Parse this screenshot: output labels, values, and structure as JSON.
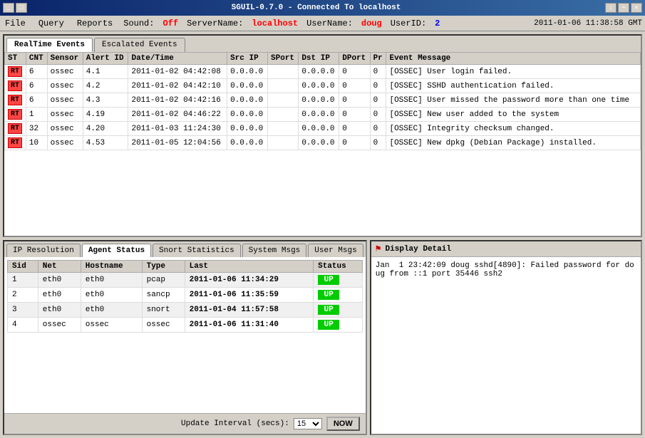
{
  "titleBar": {
    "title": "SGUIL-0.7.0 - Connected To localhost",
    "controls": [
      "minimize",
      "maximize",
      "close"
    ],
    "datetime": "2011-01-06 11:38:58 GMT"
  },
  "menuBar": {
    "items": [
      {
        "label": "File",
        "id": "file"
      },
      {
        "label": "Query",
        "id": "query"
      },
      {
        "label": "Reports",
        "id": "reports"
      }
    ],
    "sound": {
      "label": "Sound:",
      "value": "Off"
    },
    "serverName": {
      "label": "ServerName:",
      "value": "localhost"
    },
    "userName": {
      "label": "UserName:",
      "value": "doug"
    },
    "userId": {
      "label": "UserID:",
      "value": "2"
    }
  },
  "topPanel": {
    "tabs": [
      {
        "label": "RealTime Events",
        "id": "realtime",
        "active": true
      },
      {
        "label": "Escalated Events",
        "id": "escalated",
        "active": false
      }
    ],
    "tableHeaders": [
      "ST",
      "CNT",
      "Sensor",
      "Alert ID",
      "Date/Time",
      "Src IP",
      "SPort",
      "Dst IP",
      "DPort",
      "Pr",
      "Event Message"
    ],
    "rows": [
      {
        "st": "RT",
        "cnt": "6",
        "sensor": "ossec",
        "alertId": "4.1",
        "datetime": "2011-01-02 04:42:08",
        "srcIp": "0.0.0.0",
        "sport": "",
        "dstIp": "0.0.0.0",
        "dport": "0",
        "pr": "0",
        "message": "[OSSEC] User login failed."
      },
      {
        "st": "RT",
        "cnt": "6",
        "sensor": "ossec",
        "alertId": "4.2",
        "datetime": "2011-01-02 04:42:10",
        "srcIp": "0.0.0.0",
        "sport": "",
        "dstIp": "0.0.0.0",
        "dport": "0",
        "pr": "0",
        "message": "[OSSEC] SSHD authentication failed."
      },
      {
        "st": "RT",
        "cnt": "6",
        "sensor": "ossec",
        "alertId": "4.3",
        "datetime": "2011-01-02 04:42:16",
        "srcIp": "0.0.0.0",
        "sport": "",
        "dstIp": "0.0.0.0",
        "dport": "0",
        "pr": "0",
        "message": "[OSSEC] User missed the password more than one time"
      },
      {
        "st": "RT",
        "cnt": "1",
        "sensor": "ossec",
        "alertId": "4.19",
        "datetime": "2011-01-02 04:46:22",
        "srcIp": "0.0.0.0",
        "sport": "",
        "dstIp": "0.0.0.0",
        "dport": "0",
        "pr": "0",
        "message": "[OSSEC] New user added to the system"
      },
      {
        "st": "RT",
        "cnt": "32",
        "sensor": "ossec",
        "alertId": "4.20",
        "datetime": "2011-01-03 11:24:30",
        "srcIp": "0.0.0.0",
        "sport": "",
        "dstIp": "0.0.0.0",
        "dport": "0",
        "pr": "0",
        "message": "[OSSEC] Integrity checksum changed."
      },
      {
        "st": "RT",
        "cnt": "10",
        "sensor": "ossec",
        "alertId": "4.53",
        "datetime": "2011-01-05 12:04:56",
        "srcIp": "0.0.0.0",
        "sport": "",
        "dstIp": "0.0.0.0",
        "dport": "0",
        "pr": "0",
        "message": "[OSSEC] New dpkg (Debian Package) installed."
      }
    ]
  },
  "bottomLeft": {
    "tabs": [
      {
        "label": "IP Resolution",
        "id": "ip-resolution",
        "active": false
      },
      {
        "label": "Agent Status",
        "id": "agent-status",
        "active": true
      },
      {
        "label": "Snort Statistics",
        "id": "snort-statistics",
        "active": false
      },
      {
        "label": "System Msgs",
        "id": "system-msgs",
        "active": false
      },
      {
        "label": "User Msgs",
        "id": "user-msgs",
        "active": false
      }
    ],
    "agentTable": {
      "headers": [
        "Sid",
        "Net",
        "Hostname",
        "Type",
        "Last",
        "Status"
      ],
      "rows": [
        {
          "sid": "1",
          "net": "eth0",
          "hostname": "eth0",
          "type": "pcap",
          "last": "2011-01-06 11:34:29",
          "status": "UP"
        },
        {
          "sid": "2",
          "net": "eth0",
          "hostname": "eth0",
          "type": "sancp",
          "last": "2011-01-06 11:35:59",
          "status": "UP"
        },
        {
          "sid": "3",
          "net": "eth0",
          "hostname": "eth0",
          "type": "snort",
          "last": "2011-01-04 11:57:58",
          "status": "UP"
        },
        {
          "sid": "4",
          "net": "ossec",
          "hostname": "ossec",
          "type": "ossec",
          "last": "2011-01-06 11:31:40",
          "status": "UP"
        }
      ]
    },
    "controls": {
      "updateLabel": "Update Interval (secs):",
      "intervalValue": "15",
      "nowLabel": "NOW"
    }
  },
  "bottomRight": {
    "title": "Display Detail",
    "content": "Jan  1 23:42:09 doug sshd[4890]: Failed password for doug from ::1 port 35446 ssh2"
  }
}
